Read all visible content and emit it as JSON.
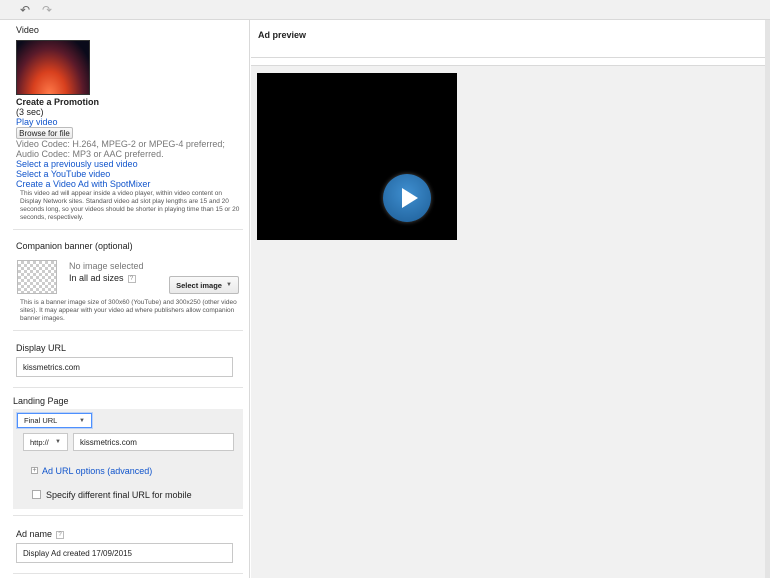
{
  "video_section": {
    "title": "Video",
    "video_name": "Create a Promotion",
    "duration": "(3 sec)",
    "play_link": "Play video",
    "browse_button": "Browse for file",
    "codec_video": "Video Codec: H.264, MPEG-2 or MPEG-4 preferred;",
    "codec_audio": "Audio Codec: MP3 or AAC preferred.",
    "link_previous": "Select a previously used video",
    "link_youtube": "Select a YouTube video",
    "link_spotmixer": "Create a Video Ad with SpotMixer",
    "help_text": "This video ad will appear inside a video player, within video content on Display Network sites. Standard video ad slot play lengths are 15 and 20 seconds long, so your videos should be shorter in playing time than 15 or 20 seconds, respectively."
  },
  "companion_banner": {
    "title": "Companion banner (optional)",
    "no_image": "No image selected",
    "sizes": "In all ad sizes",
    "help_icon": "?",
    "select_button": "Select image",
    "help_text": "This is a banner image size of 300x60 (YouTube) and 300x250 (other video sites). It may appear with your video ad where publishers allow companion banner images."
  },
  "display_url": {
    "title": "Display URL",
    "value": "kissmetrics.com"
  },
  "landing_page": {
    "title": "Landing Page",
    "url_type": "Final URL",
    "protocol": "http://",
    "value": "kissmetrics.com",
    "plus_icon": "+",
    "options_link": "Ad URL options (advanced)",
    "mobile_checkbox_label": "Specify different final URL for mobile"
  },
  "ad_name": {
    "title": "Ad name",
    "help_icon": "?",
    "value": "Display Ad created 17/09/2015"
  },
  "preview": {
    "title": "Ad preview"
  },
  "toolbar": {
    "undo_icon": "↶",
    "redo_icon": "↷"
  }
}
